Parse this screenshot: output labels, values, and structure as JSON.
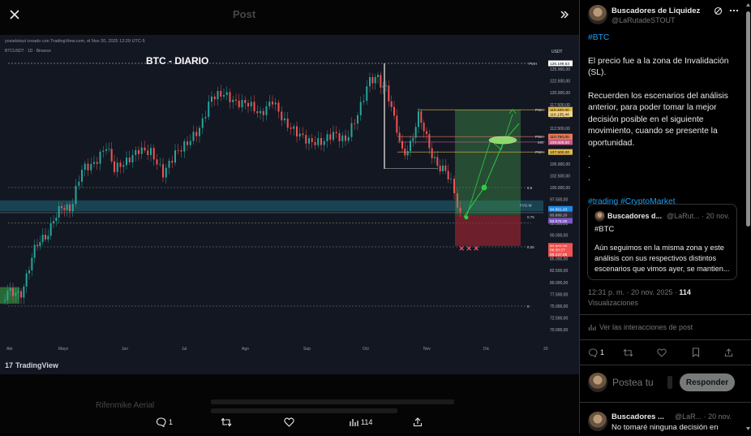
{
  "viewer": {
    "background_post_title": "Post",
    "background_author": "Rifenmike Aerial",
    "chart_header": "yosielstout creado con TradingView.com, el Nov 20, 2025 12:29 UTC-5",
    "chart_symbol": "BTCUSDT · 1D · Binance",
    "chart_title": "BTC - DIARIO",
    "tv_logo": "TradingView",
    "currency": "USDT",
    "price_labels": [
      "125.000,00",
      "122.500,00",
      "120.000,00",
      "117.500,00",
      "115.000,00",
      "112.500,00",
      "110.000,00",
      "107.500,00",
      "105.000,00",
      "102.500,00",
      "100.000,00",
      "97.500,00",
      "95.000,00",
      "92.500,00",
      "90.000,00",
      "87.500,00",
      "85.000,00",
      "82.500,00",
      "80.000,00",
      "77.500,00",
      "75.000,00",
      "72.500,00",
      "70.000,00"
    ],
    "month_labels": [
      "Abr",
      "Mayo",
      "Jun",
      "Jul",
      "Ago",
      "Sep",
      "Oct",
      "Nov",
      "Dic",
      "20"
    ],
    "level_labels": [
      "PMH",
      "PWH",
      "PWH",
      "MO",
      "PWH",
      "0.5",
      "FVG-M",
      "0.75",
      "0.25",
      "0"
    ],
    "price_tags": [
      "126.199,63",
      "116.400,00",
      "116.135,44",
      "110.750,00",
      "109.608,00",
      "107.500,00",
      "94.861,43",
      "93.669,10",
      "93.576,00",
      "87.502,00",
      "06:30:27",
      "86.137,85"
    ],
    "actions": {
      "replies": "1",
      "reposts": "",
      "likes": "",
      "views": "114",
      "share": ""
    }
  },
  "tweet": {
    "author_name": "Buscadores de Liquidez",
    "author_handle": "@LaRutadeSTOUT",
    "hashtag_top": "#BTC",
    "body": "El precio fue a la zona de Invalidación (SL).\n\nRecuerden los escenarios del análisis anterior, para poder tomar la mejor decisión posible en el siguiente movimiento, cuando se presente la oportunidad.\n.\n.\n.",
    "hashtags_bottom": "#trading #CryptoMarket",
    "quote": {
      "name": "Buscadores d...",
      "handle": "@LaRut...",
      "date": "· 20 nov.",
      "tag": "#BTC",
      "body": "Aún seguimos en la misma zona y este análisis con sus respectivos distintos escenarios que vimos ayer, se mantien..."
    },
    "timestamp": "12:31 p. m. · 20 nov. 2025 ·",
    "views_count": "114",
    "views_label": "Visualizaciones",
    "interactions_link": "Ver las interacciones de post"
  },
  "reply_box": {
    "placeholder": "Postea tu",
    "button": "Responder"
  },
  "reply": {
    "name": "Buscadores ...",
    "handle": "@LaR... · 20 nov.",
    "text": "No tomaré ninguna decisión en"
  },
  "colors": {
    "accent": "#1d9bf0",
    "bull": "#26a69a",
    "bear": "#ef5350",
    "chart_bg": "#131722"
  }
}
